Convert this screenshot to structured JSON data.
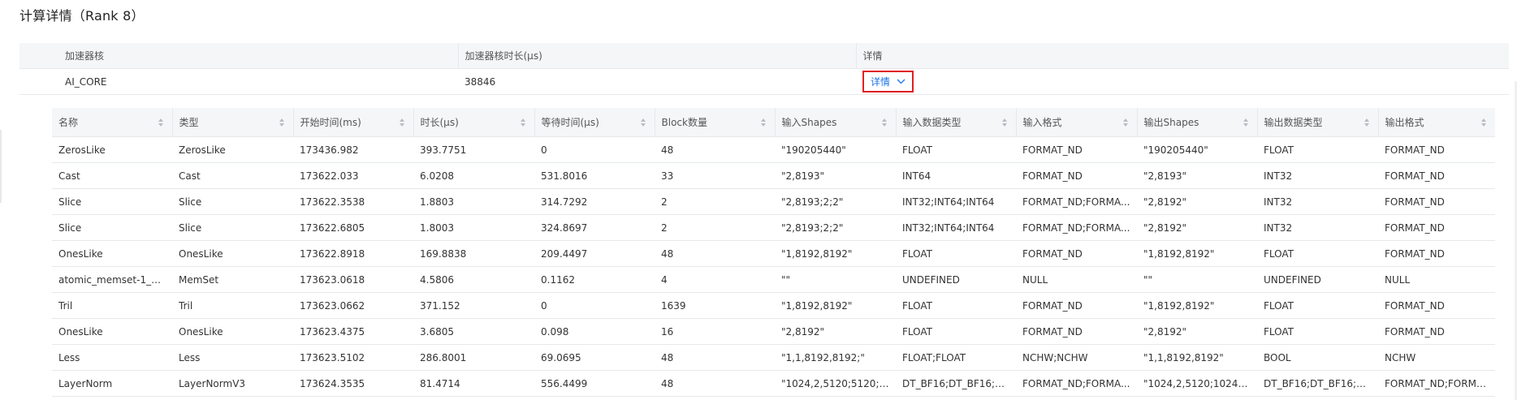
{
  "title": "计算详情（Rank 8）",
  "summary": {
    "headers": [
      "加速器核",
      "加速器核时长(μs)",
      "详情"
    ],
    "row": {
      "core": "AI_CORE",
      "duration": "38846",
      "detail_label": "详情"
    }
  },
  "columns": [
    "名称",
    "类型",
    "开始时间(ms)",
    "时长(μs)",
    "等待时间(μs)",
    "Block数量",
    "输入Shapes",
    "输入数据类型",
    "输入格式",
    "输出Shapes",
    "输出数据类型",
    "输出格式"
  ],
  "rows": [
    [
      "ZerosLike",
      "ZerosLike",
      "173436.982",
      "393.7751",
      "0",
      "48",
      "\"190205440\"",
      "FLOAT",
      "FORMAT_ND",
      "\"190205440\"",
      "FLOAT",
      "FORMAT_ND"
    ],
    [
      "Cast",
      "Cast",
      "173622.033",
      "6.0208",
      "531.8016",
      "33",
      "\"2,8193\"",
      "INT64",
      "FORMAT_ND",
      "\"2,8193\"",
      "INT32",
      "FORMAT_ND"
    ],
    [
      "Slice",
      "Slice",
      "173622.3538",
      "1.8803",
      "314.7292",
      "2",
      "\"2,8193;2;2\"",
      "INT32;INT64;INT64",
      "FORMAT_ND;FORMA...",
      "\"2,8192\"",
      "INT32",
      "FORMAT_ND"
    ],
    [
      "Slice",
      "Slice",
      "173622.6805",
      "1.8003",
      "324.8697",
      "2",
      "\"2,8193;2;2\"",
      "INT32;INT64;INT64",
      "FORMAT_ND;FORMA...",
      "\"2,8192\"",
      "INT32",
      "FORMAT_ND"
    ],
    [
      "OnesLike",
      "OnesLike",
      "173622.8918",
      "169.8838",
      "209.4497",
      "48",
      "\"1,8192,8192\"",
      "FLOAT",
      "FORMAT_ND",
      "\"1,8192,8192\"",
      "FLOAT",
      "FORMAT_ND"
    ],
    [
      "atomic_memset-1_69...",
      "MemSet",
      "173623.0618",
      "4.5806",
      "0.1162",
      "4",
      "\"\"",
      "UNDEFINED",
      "NULL",
      "\"\"",
      "UNDEFINED",
      "NULL"
    ],
    [
      "Tril",
      "Tril",
      "173623.0662",
      "371.152",
      "0",
      "1639",
      "\"1,8192,8192\"",
      "FLOAT",
      "FORMAT_ND",
      "\"1,8192,8192\"",
      "FLOAT",
      "FORMAT_ND"
    ],
    [
      "OnesLike",
      "OnesLike",
      "173623.4375",
      "3.6805",
      "0.098",
      "16",
      "\"2,8192\"",
      "FLOAT",
      "FORMAT_ND",
      "\"2,8192\"",
      "FLOAT",
      "FORMAT_ND"
    ],
    [
      "Less",
      "Less",
      "173623.5102",
      "286.8001",
      "69.0695",
      "48",
      "\"1,1,8192,8192;\"",
      "FLOAT;FLOAT",
      "NCHW;NCHW",
      "\"1,1,8192,8192\"",
      "BOOL",
      "NCHW"
    ],
    [
      "LayerNorm",
      "LayerNormV3",
      "173624.3535",
      "81.4714",
      "556.4499",
      "48",
      "\"1024,2,5120;5120;51...",
      "DT_BF16;DT_BF16;DT...",
      "FORMAT_ND;FORMA...",
      "\"1024,2,5120;1024,2,...",
      "DT_BF16;DT_BF16;DT...",
      "FORMAT_ND;FORMA..."
    ]
  ],
  "colors": {
    "link": "#1a73e8",
    "highlight_border": "#e02020",
    "header_bg": "#f5f6f8"
  },
  "icons": {
    "expand": "chevron-down-icon",
    "sort": "sort-icon"
  }
}
